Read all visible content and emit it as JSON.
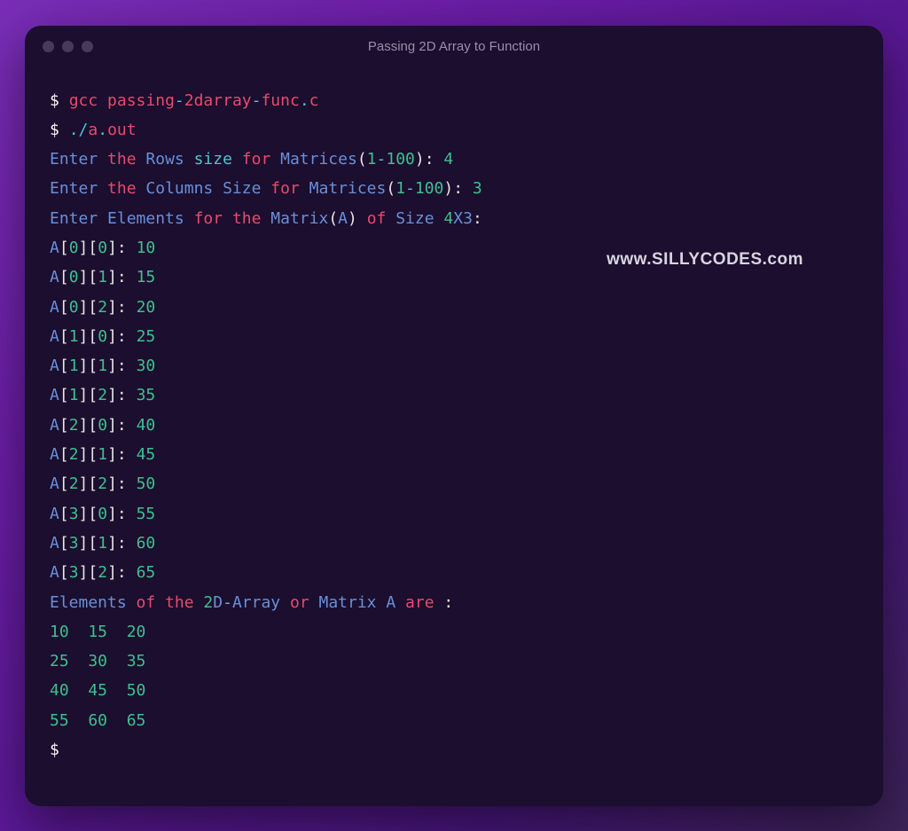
{
  "window": {
    "title": "Passing 2D Array to Function"
  },
  "watermark": "www.SILLYCODES.com",
  "cmd1": {
    "prompt": "$ ",
    "p1": "gcc ",
    "p2": "passing",
    "p3": "-",
    "p4": "2",
    "p5": "darray",
    "p6": "-",
    "p7": "func",
    "p8": ".",
    "p9": "c"
  },
  "cmd2": {
    "prompt": "$ ",
    "p1": ".",
    "p2": "/",
    "p3": "a",
    "p4": ".",
    "p5": "out"
  },
  "l3": {
    "a": "Enter ",
    "b": "the ",
    "c": "Rows ",
    "d": "size ",
    "e": "for ",
    "f": "Matrices",
    "g": "(",
    "h": "1",
    "i": "-",
    "j": "100",
    "k": "): ",
    "v": "4"
  },
  "l4": {
    "a": "Enter ",
    "b": "the ",
    "c": "Columns ",
    "d": "Size ",
    "e": "for ",
    "f": "Matrices",
    "g": "(",
    "h": "1",
    "i": "-",
    "j": "100",
    "k": "): ",
    "v": "3"
  },
  "l5": {
    "a": "Enter ",
    "b": "Elements ",
    "c": "for ",
    "d": "the ",
    "e": "Matrix",
    "f": "(",
    "g": "A",
    "h": ") ",
    "i": "of ",
    "j": "Size ",
    "k": "4",
    "l": "X3",
    "m": ":"
  },
  "cells": [
    {
      "arr": "A",
      "b1": "[",
      "i": "0",
      "b2": "][",
      "j": "0",
      "b3": "]: ",
      "v": "10"
    },
    {
      "arr": "A",
      "b1": "[",
      "i": "0",
      "b2": "][",
      "j": "1",
      "b3": "]: ",
      "v": "15"
    },
    {
      "arr": "A",
      "b1": "[",
      "i": "0",
      "b2": "][",
      "j": "2",
      "b3": "]: ",
      "v": "20"
    },
    {
      "arr": "A",
      "b1": "[",
      "i": "1",
      "b2": "][",
      "j": "0",
      "b3": "]: ",
      "v": "25"
    },
    {
      "arr": "A",
      "b1": "[",
      "i": "1",
      "b2": "][",
      "j": "1",
      "b3": "]: ",
      "v": "30"
    },
    {
      "arr": "A",
      "b1": "[",
      "i": "1",
      "b2": "][",
      "j": "2",
      "b3": "]: ",
      "v": "35"
    },
    {
      "arr": "A",
      "b1": "[",
      "i": "2",
      "b2": "][",
      "j": "0",
      "b3": "]: ",
      "v": "40"
    },
    {
      "arr": "A",
      "b1": "[",
      "i": "2",
      "b2": "][",
      "j": "1",
      "b3": "]: ",
      "v": "45"
    },
    {
      "arr": "A",
      "b1": "[",
      "i": "2",
      "b2": "][",
      "j": "2",
      "b3": "]: ",
      "v": "50"
    },
    {
      "arr": "A",
      "b1": "[",
      "i": "3",
      "b2": "][",
      "j": "0",
      "b3": "]: ",
      "v": "55"
    },
    {
      "arr": "A",
      "b1": "[",
      "i": "3",
      "b2": "][",
      "j": "1",
      "b3": "]: ",
      "v": "60"
    },
    {
      "arr": "A",
      "b1": "[",
      "i": "3",
      "b2": "][",
      "j": "2",
      "b3": "]: ",
      "v": "65"
    }
  ],
  "l18": {
    "a": "Elements ",
    "b": "of ",
    "c": "the ",
    "d": "2",
    "e": "D",
    "f": "-",
    "g": "Array ",
    "h": "or ",
    "i": "Matrix ",
    "j": "A ",
    "k": "are ",
    "l": ":"
  },
  "matrix": [
    "10  15  20",
    "25  30  35",
    "40  45  50",
    "55  60  65"
  ],
  "final_prompt": "$ "
}
